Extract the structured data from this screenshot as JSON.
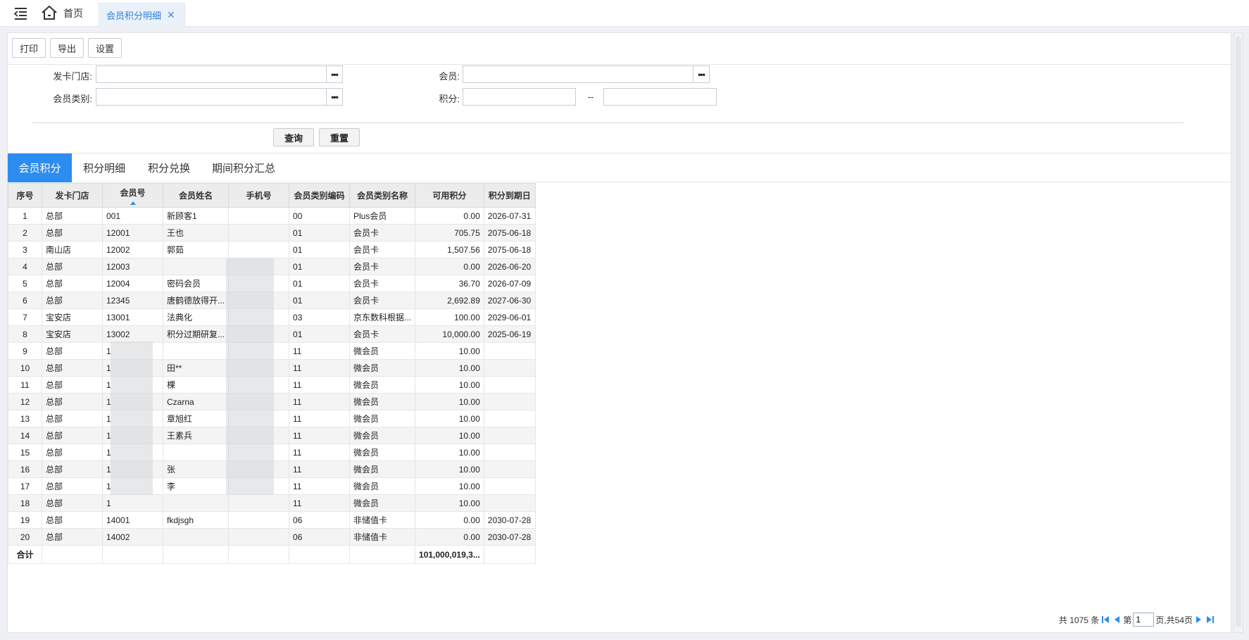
{
  "topbar": {
    "home_label": "首页",
    "active_tab_label": "会员积分明细",
    "close_glyph": "✕"
  },
  "toolbar": {
    "print_label": "打印",
    "export_label": "导出",
    "settings_label": "设置"
  },
  "filters": {
    "store_label": "发卡门店:",
    "store_value": "",
    "member_label": "会员:",
    "member_value": "",
    "category_label": "会员类别:",
    "category_value": "",
    "points_label": "积分:",
    "points_from": "",
    "points_to": "",
    "range_sep": "--",
    "dots": "•••",
    "query_label": "查询",
    "reset_label": "重置"
  },
  "section_tabs": [
    "会员积分",
    "积分明细",
    "积分兑换",
    "期间积分汇总"
  ],
  "table": {
    "headers": [
      "序号",
      "发卡门店",
      "会员号",
      "会员姓名",
      "手机号",
      "会员类别编码",
      "会员类别名称",
      "可用积分",
      "积分到期日"
    ],
    "rows": [
      [
        "1",
        "总部",
        "001",
        "新顾客1",
        "",
        "00",
        "Plus会员",
        "0.00",
        "2026-07-31"
      ],
      [
        "2",
        "总部",
        "12001",
        "王也",
        "",
        "01",
        "会员卡",
        "705.75",
        "2075-06-18"
      ],
      [
        "3",
        "南山店",
        "12002",
        "郭茹",
        "",
        "01",
        "会员卡",
        "1,507.56",
        "2075-06-18"
      ],
      [
        "4",
        "总部",
        "12003",
        "",
        "",
        "01",
        "会员卡",
        "0.00",
        "2026-06-20"
      ],
      [
        "5",
        "总部",
        "12004",
        "密码会员",
        "",
        "01",
        "会员卡",
        "36.70",
        "2026-07-09"
      ],
      [
        "6",
        "总部",
        "12345",
        "唐鹤德放得开...",
        "",
        "01",
        "会员卡",
        "2,692.89",
        "2027-06-30"
      ],
      [
        "7",
        "宝安店",
        "13001",
        "法典化",
        "",
        "03",
        "京东数科根据...",
        "100.00",
        "2029-06-01"
      ],
      [
        "8",
        "宝安店",
        "13002",
        "积分过期研复...",
        "",
        "01",
        "会员卡",
        "10,000.00",
        "2025-06-19"
      ],
      [
        "9",
        "总部",
        "1",
        "",
        "",
        "11",
        "微会员",
        "10.00",
        ""
      ],
      [
        "10",
        "总部",
        "1",
        "田**",
        "",
        "11",
        "微会员",
        "10.00",
        ""
      ],
      [
        "11",
        "总部",
        "1",
        "棵",
        "",
        "11",
        "微会员",
        "10.00",
        ""
      ],
      [
        "12",
        "总部",
        "1",
        "Czarna",
        "",
        "11",
        "微会员",
        "10.00",
        ""
      ],
      [
        "13",
        "总部",
        "1",
        "章旭红",
        "",
        "11",
        "微会员",
        "10.00",
        ""
      ],
      [
        "14",
        "总部",
        "1",
        "王素兵",
        "",
        "11",
        "微会员",
        "10.00",
        ""
      ],
      [
        "15",
        "总部",
        "1",
        "",
        "",
        "11",
        "微会员",
        "10.00",
        ""
      ],
      [
        "16",
        "总部",
        "1",
        "张",
        "",
        "11",
        "微会员",
        "10.00",
        ""
      ],
      [
        "17",
        "总部",
        "1",
        "李",
        "",
        "11",
        "微会员",
        "10.00",
        ""
      ],
      [
        "18",
        "总部",
        "1",
        "",
        "",
        "11",
        "微会员",
        "10.00",
        ""
      ],
      [
        "19",
        "总部",
        "14001",
        "fkdjsgh",
        "",
        "06",
        "非储值卡",
        "0.00",
        "2030-07-28"
      ],
      [
        "20",
        "总部",
        "14002",
        "",
        "",
        "06",
        "非储值卡",
        "0.00",
        "2030-07-28"
      ]
    ],
    "total_label": "合计",
    "total_points": "101,000,019,3..."
  },
  "pager": {
    "total_text": "共 1075 条",
    "page_prefix": "第",
    "current_page": "1",
    "page_suffix": "页,共54页"
  },
  "colors": {
    "accent": "#2d8cf0",
    "tab_text": "#2f7fd6"
  }
}
